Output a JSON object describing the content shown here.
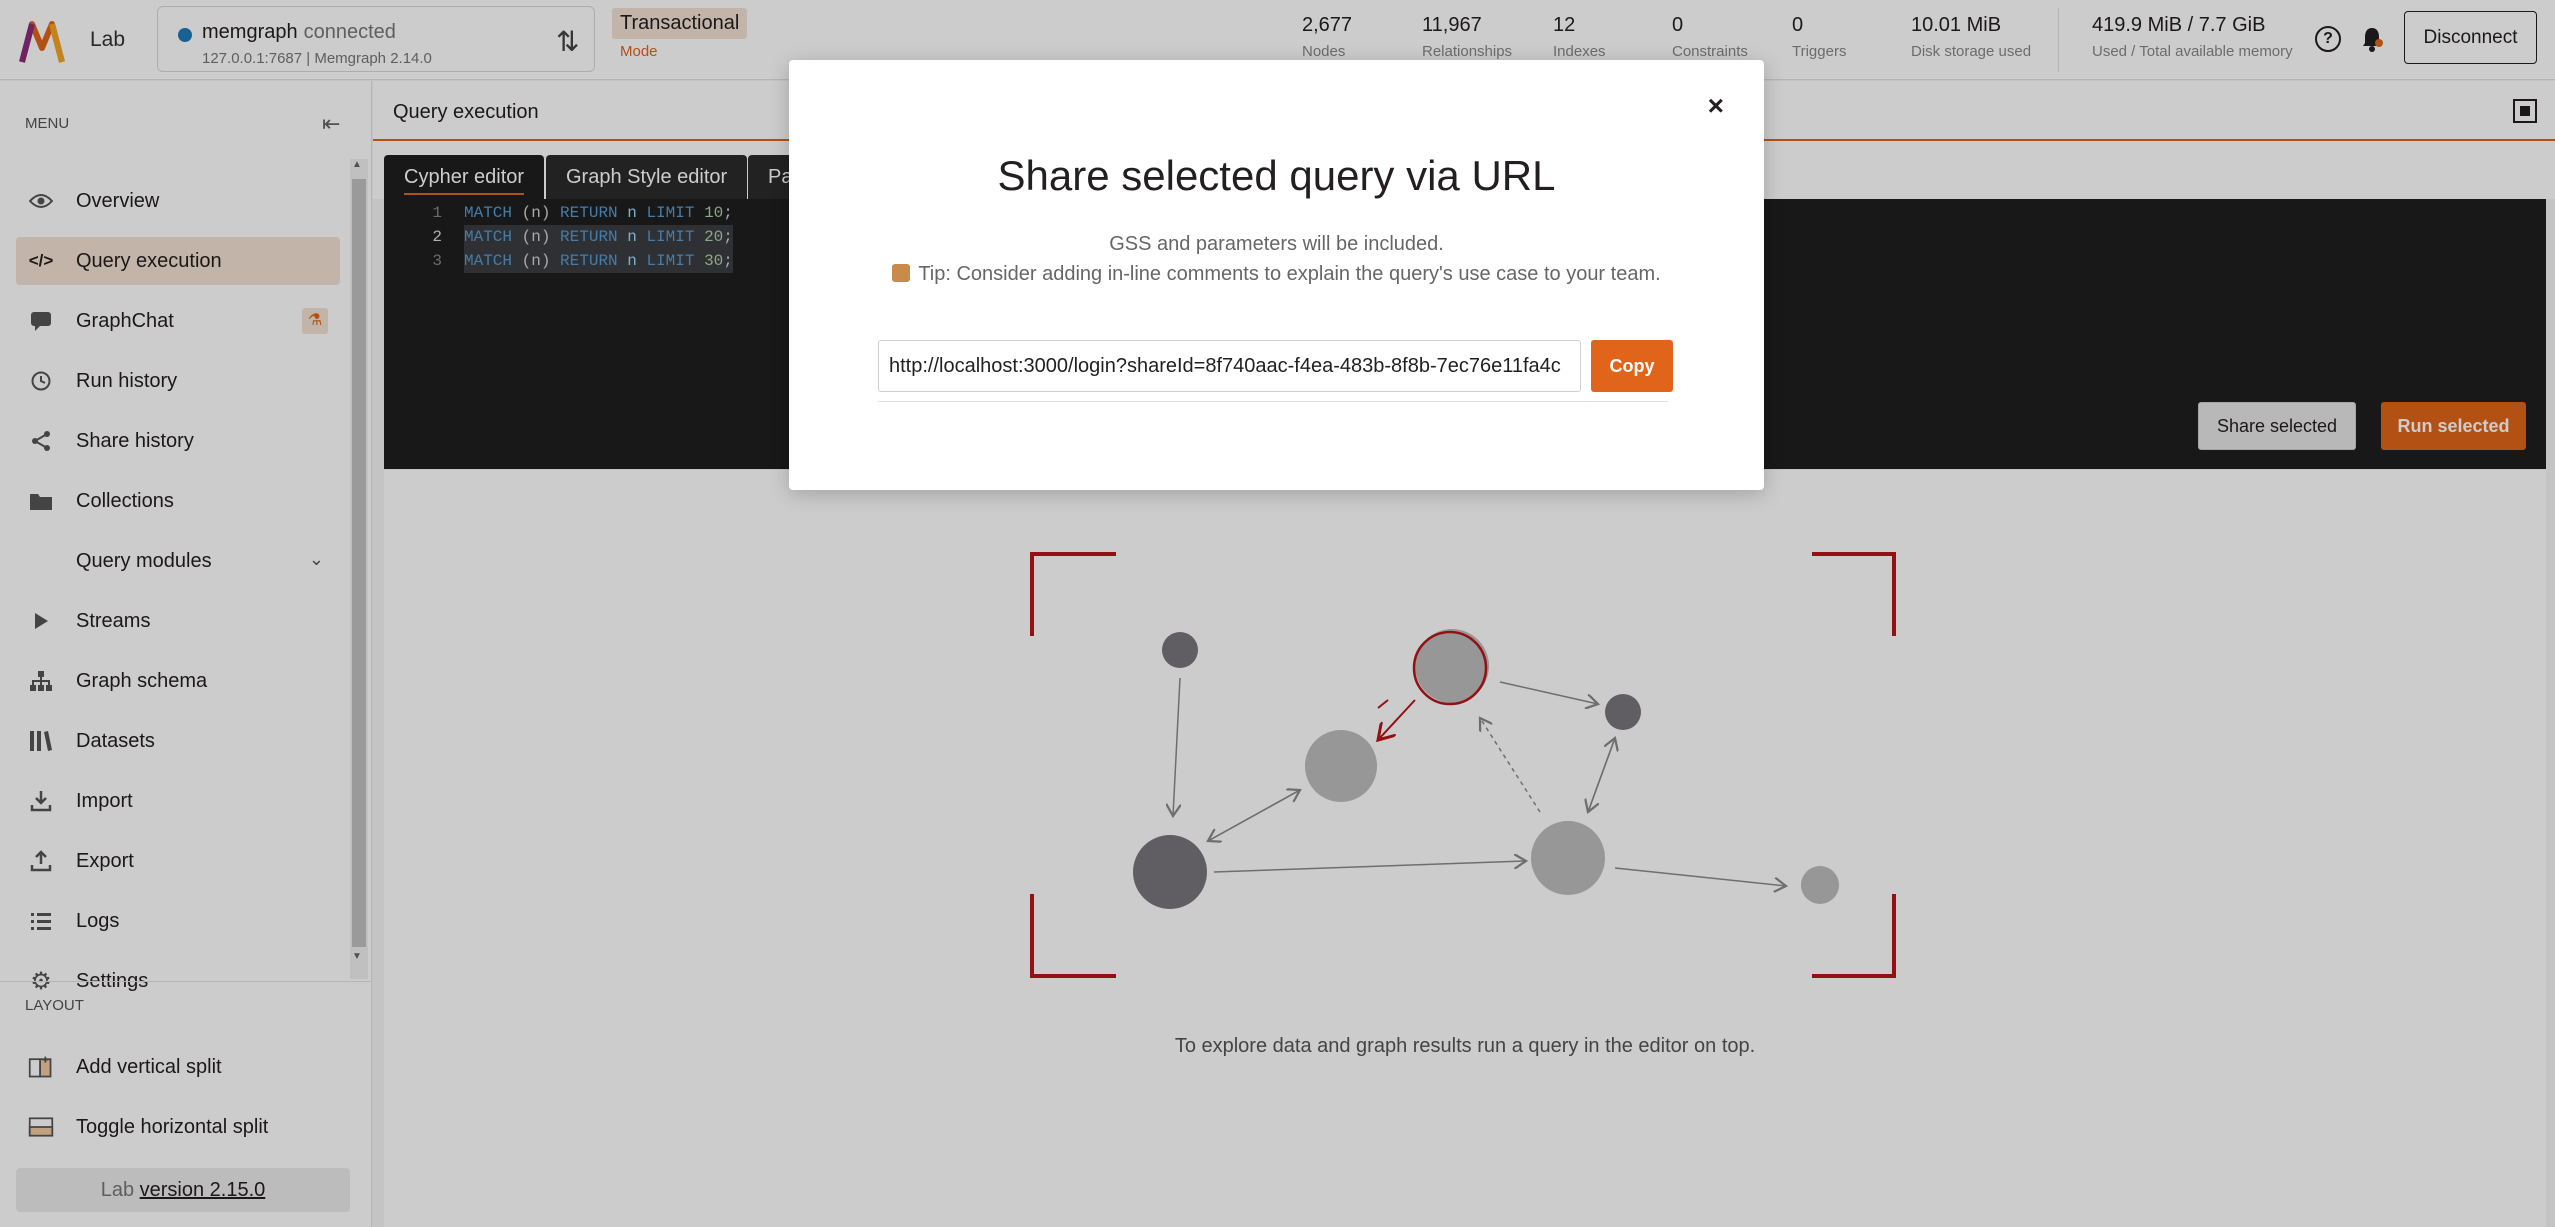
{
  "app": {
    "title": "Lab"
  },
  "connection": {
    "name": "memgraph",
    "status": "connected",
    "address": "127.0.0.1:7687",
    "version": "Memgraph 2.14.0"
  },
  "mode": {
    "value": "Transactional",
    "label": "Mode"
  },
  "stats": [
    {
      "value": "2,677",
      "label": "Nodes"
    },
    {
      "value": "11,967",
      "label": "Relationships"
    },
    {
      "value": "12",
      "label": "Indexes"
    },
    {
      "value": "0",
      "label": "Constraints"
    },
    {
      "value": "0",
      "label": "Triggers"
    },
    {
      "value": "10.01 MiB",
      "label": "Disk storage used"
    },
    {
      "value": "419.9 MiB / 7.7 GiB",
      "label": "Used / Total available memory"
    }
  ],
  "header": {
    "disconnect_label": "Disconnect"
  },
  "sidebar": {
    "menu_label": "MENU",
    "items": [
      {
        "label": "Overview",
        "icon": "eye-icon"
      },
      {
        "label": "Query execution",
        "icon": "code-icon"
      },
      {
        "label": "GraphChat",
        "icon": "chat-icon"
      },
      {
        "label": "Run history",
        "icon": "history-icon"
      },
      {
        "label": "Share history",
        "icon": "share-icon"
      },
      {
        "label": "Collections",
        "icon": "folder-icon"
      },
      {
        "label": "Query modules",
        "icon": "modules-icon"
      },
      {
        "label": "Streams",
        "icon": "play-icon"
      },
      {
        "label": "Graph schema",
        "icon": "schema-icon"
      },
      {
        "label": "Datasets",
        "icon": "library-icon"
      },
      {
        "label": "Import",
        "icon": "download-icon"
      },
      {
        "label": "Export",
        "icon": "upload-icon"
      },
      {
        "label": "Logs",
        "icon": "list-icon"
      },
      {
        "label": "Settings",
        "icon": "gear-icon"
      }
    ],
    "layout_label": "LAYOUT",
    "layout_items": [
      {
        "label": "Add vertical split"
      },
      {
        "label": "Toggle horizontal split"
      }
    ],
    "version_prefix": "Lab",
    "version_link": "version 2.15.0"
  },
  "panel": {
    "title": "Query execution"
  },
  "tabs": [
    {
      "label": "Cypher editor"
    },
    {
      "label": "Graph Style editor"
    },
    {
      "label": "Pa"
    }
  ],
  "editor": {
    "lines": [
      {
        "num": "1",
        "kw1": "MATCH",
        "mid": " (n) ",
        "kw2": "RETURN",
        "var": " n ",
        "kw3": "LIMIT",
        "val": " 10",
        "end": ";"
      },
      {
        "num": "2",
        "kw1": "MATCH",
        "mid": " (n) ",
        "kw2": "RETURN",
        "var": " n ",
        "kw3": "LIMIT",
        "val": " 20",
        "end": ";"
      },
      {
        "num": "3",
        "kw1": "MATCH",
        "mid": " (n) ",
        "kw2": "RETURN",
        "var": " n ",
        "kw3": "LIMIT",
        "val": " 30",
        "end": ";"
      }
    ],
    "share_label": "Share selected",
    "run_label": "Run selected"
  },
  "results": {
    "empty_text": "To explore data and graph results run a query in the editor on top."
  },
  "modal": {
    "title": "Share selected query via URL",
    "subtitle": "GSS and parameters will be included.",
    "tip": "Tip: Consider adding in-line comments to explain the query's use case to your team.",
    "url": "http://localhost:3000/login?shareId=8f740aac-f4ea-483b-8f8b-7ec76e11fa4c",
    "copy_label": "Copy",
    "close_label": "×"
  },
  "colors": {
    "accent": "#e0641a",
    "accent_light": "#f3e1d2",
    "editor_bg": "#1e1e1e"
  }
}
